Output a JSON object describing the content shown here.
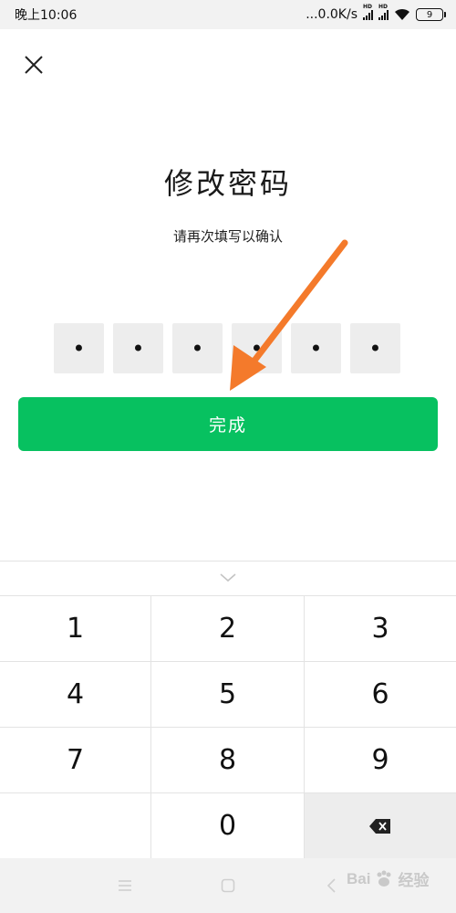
{
  "status_bar": {
    "time": "晚上10:06",
    "network_speed": "...0.0K/s",
    "signal_badge": "HD",
    "battery_level": "9"
  },
  "dialog": {
    "title": "修改密码",
    "subtitle": "请再次填写以确认"
  },
  "pin": {
    "length": 6,
    "filled": 6,
    "mask_char": "•"
  },
  "done_button": {
    "label": "完成"
  },
  "keypad": {
    "keys": [
      "1",
      "2",
      "3",
      "4",
      "5",
      "6",
      "7",
      "8",
      "9",
      "",
      "0",
      "backspace"
    ]
  },
  "annotation": {
    "color": "#f47a2b"
  },
  "watermark": {
    "brand": "Bai",
    "suffix": "经验"
  },
  "colors": {
    "accent": "#07c160",
    "pin_box": "#ededed",
    "status_bar": "#f2f2f2"
  }
}
